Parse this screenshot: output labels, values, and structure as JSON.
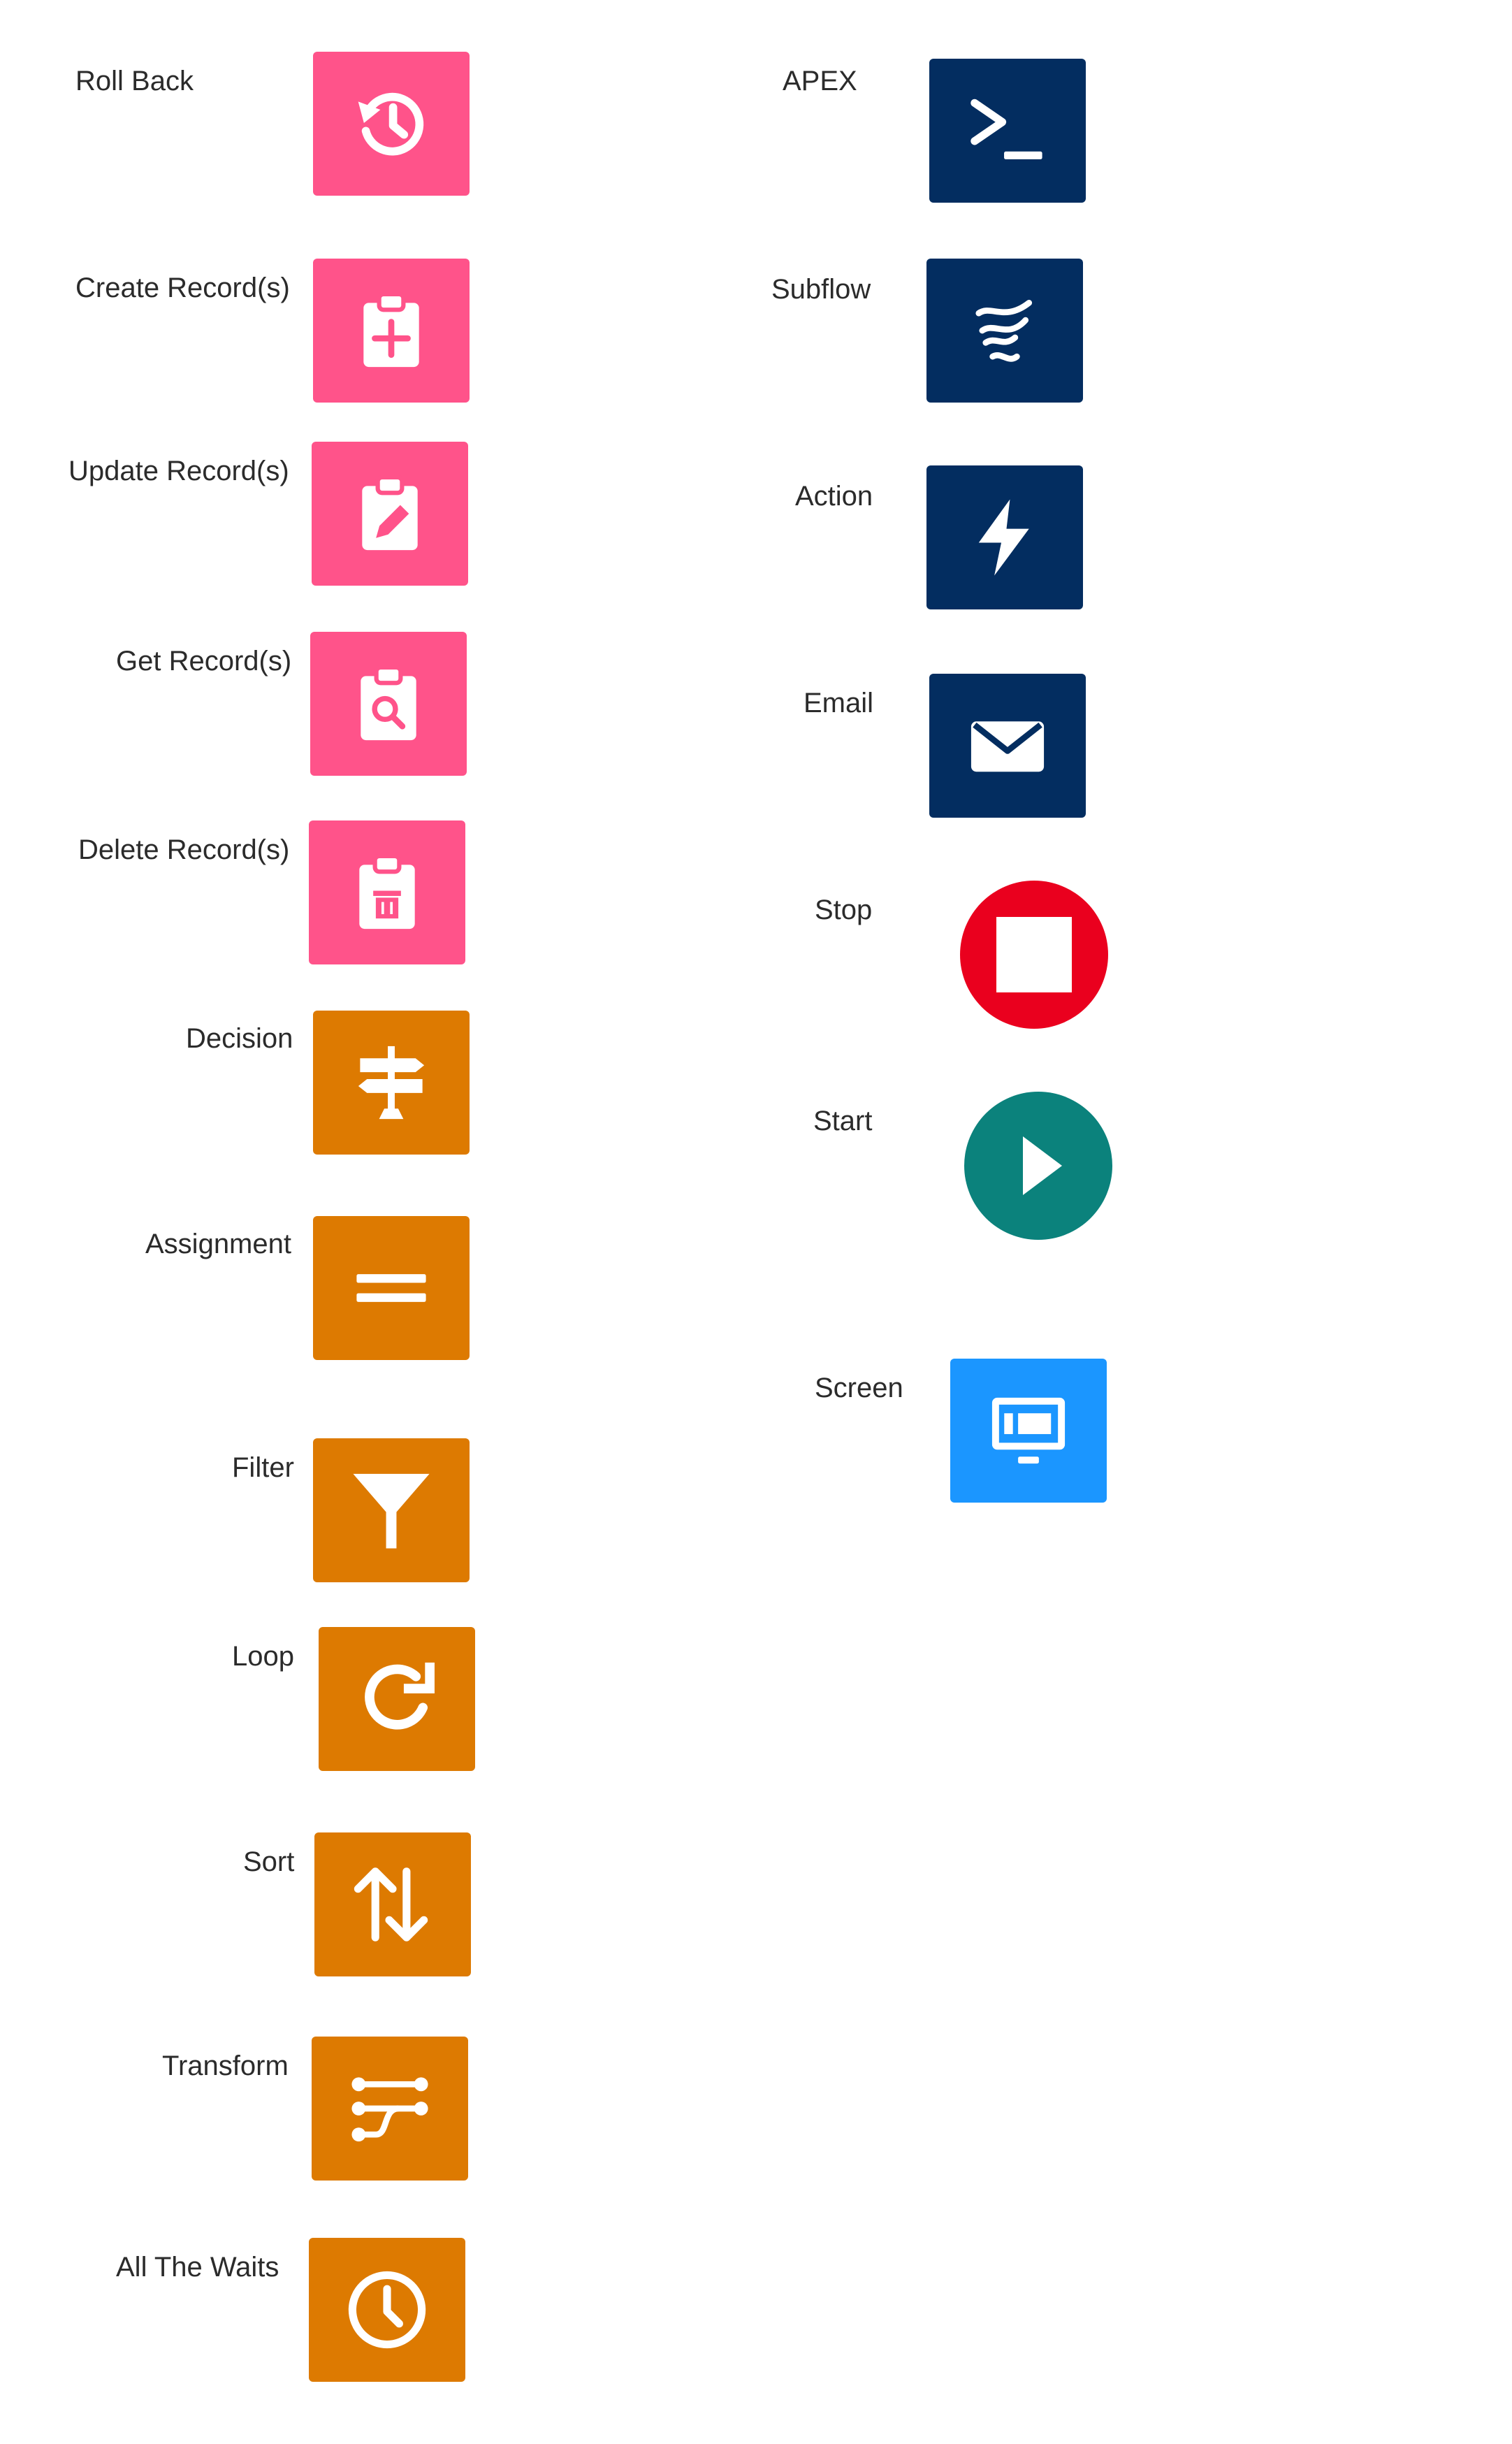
{
  "colors": {
    "pink": "#FF538A",
    "orange": "#DD7A01",
    "navy": "#032D60",
    "red": "#EA001E",
    "teal": "#0B827C",
    "blue": "#1B96FF",
    "icon_fg": "#ffffff"
  },
  "left_column": [
    {
      "label": "Roll Back",
      "icon": "rollback-icon"
    },
    {
      "label": "Create Record(s)",
      "icon": "create-record-icon"
    },
    {
      "label": "Update Record(s)",
      "icon": "update-record-icon"
    },
    {
      "label": "Get Record(s)",
      "icon": "get-record-icon"
    },
    {
      "label": "Delete Record(s)",
      "icon": "delete-record-icon"
    },
    {
      "label": "Decision",
      "icon": "decision-icon"
    },
    {
      "label": "Assignment",
      "icon": "assignment-icon"
    },
    {
      "label": "Filter",
      "icon": "filter-icon"
    },
    {
      "label": "Loop",
      "icon": "loop-icon"
    },
    {
      "label": "Sort",
      "icon": "sort-icon"
    },
    {
      "label": "Transform",
      "icon": "transform-icon"
    },
    {
      "label": "All The Waits",
      "icon": "wait-clock-icon"
    }
  ],
  "right_column": [
    {
      "label": "APEX",
      "icon": "apex-terminal-icon"
    },
    {
      "label": "Subflow",
      "icon": "subflow-icon"
    },
    {
      "label": "Action",
      "icon": "action-bolt-icon"
    },
    {
      "label": "Email",
      "icon": "email-icon"
    },
    {
      "label": "Stop",
      "icon": "stop-icon"
    },
    {
      "label": "Start",
      "icon": "start-play-icon"
    },
    {
      "label": "Screen",
      "icon": "screen-icon"
    }
  ]
}
